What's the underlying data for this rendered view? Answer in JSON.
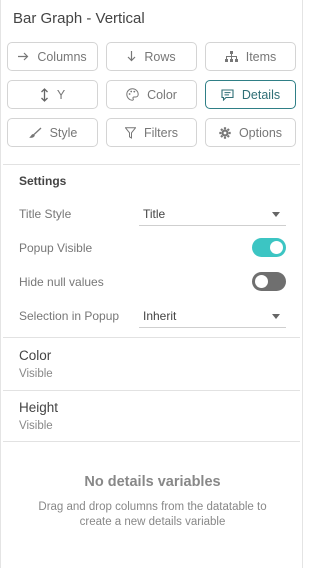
{
  "header": {
    "title": "Bar Graph - Vertical"
  },
  "tabs": [
    {
      "label": "Columns",
      "icon": "arrow-right-icon"
    },
    {
      "label": "Rows",
      "icon": "arrow-down-icon"
    },
    {
      "label": "Items",
      "icon": "hierarchy-icon"
    },
    {
      "label": "Y",
      "icon": "vertical-arrows-icon"
    },
    {
      "label": "Color",
      "icon": "palette-icon"
    },
    {
      "label": "Details",
      "icon": "comment-icon",
      "active": true
    },
    {
      "label": "Style",
      "icon": "brush-icon"
    },
    {
      "label": "Filters",
      "icon": "filter-icon"
    },
    {
      "label": "Options",
      "icon": "gear-icon"
    }
  ],
  "settings": {
    "heading": "Settings",
    "title_style": {
      "label": "Title Style",
      "value": "Title"
    },
    "popup_visible": {
      "label": "Popup Visible",
      "on": true
    },
    "hide_null": {
      "label": "Hide null values",
      "on": false
    },
    "selection_popup": {
      "label": "Selection in Popup",
      "value": "Inherit"
    }
  },
  "items": [
    {
      "title": "Color",
      "sub": "Visible"
    },
    {
      "title": "Height",
      "sub": "Visible"
    }
  ],
  "empty_state": {
    "title": "No details variables",
    "description": "Drag and drop columns from the datatable to create a new details variable"
  },
  "colors": {
    "accent": "#3cc5c3",
    "active_border": "#2f7f86",
    "toggle_off": "#6f6f6f"
  }
}
